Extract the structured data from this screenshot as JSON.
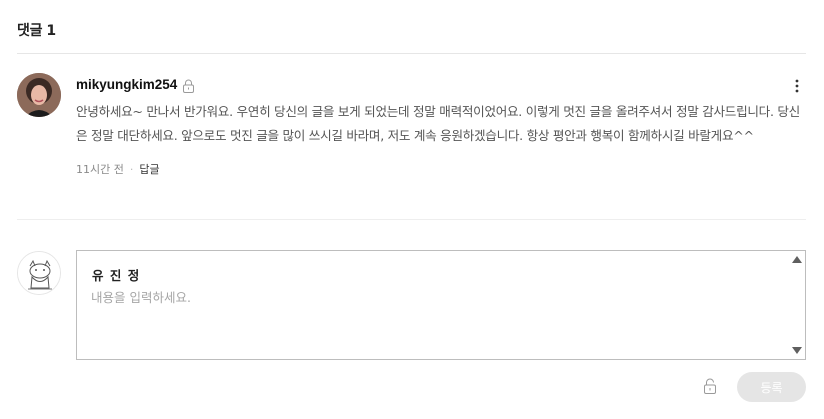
{
  "comments_header": {
    "label": "댓글",
    "count": "1"
  },
  "comment": {
    "author": "mikyungkim254",
    "text": "안녕하세요~ 만나서 반가워요. 우연히 당신의 글을 보게 되었는데 정말 매력적이었어요. 이렇게 멋진 글을 올려주셔서 정말 감사드립니다. 당신은 정말 대단하세요. 앞으로도 멋진 글을 많이 쓰시길 바라며, 저도 계속 응원하겠습니다. 항상 평안과 행복이 함께하시길 바랄게요^^",
    "time": "11시간 전",
    "reply_label": "답글",
    "icons": {
      "lock": "lock-icon",
      "more": "more-vertical-icon"
    }
  },
  "composer": {
    "user_name": "유 진 정",
    "placeholder": "내용을 입력하세요.",
    "value": "",
    "submit_label": "등록",
    "icons": {
      "secret": "lock-icon"
    }
  },
  "colors": {
    "submit_disabled_bg": "#e5e5e5",
    "divider": "#e6e6e6",
    "text_muted": "#8a8a8a"
  }
}
